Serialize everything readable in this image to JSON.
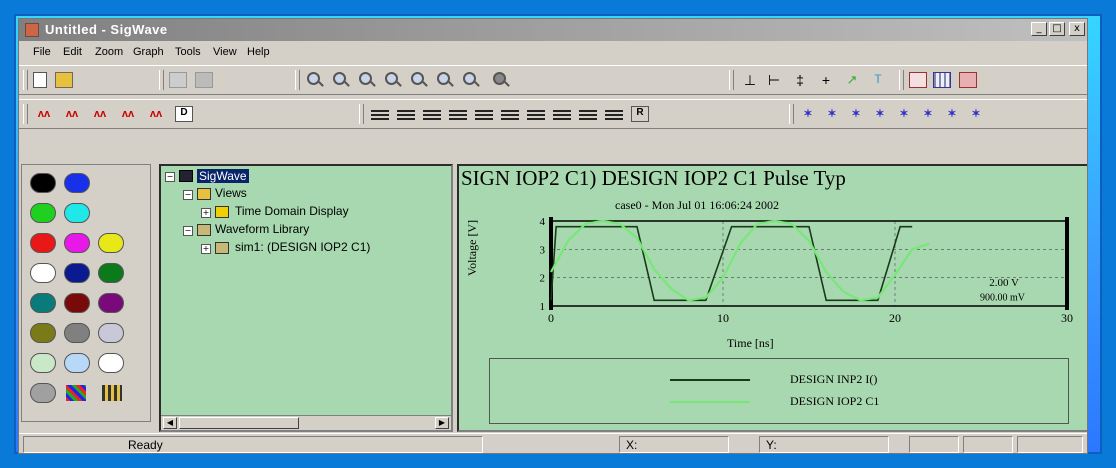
{
  "window": {
    "title": "Untitled - SigWave",
    "min": "_",
    "max": "□",
    "close": "x"
  },
  "menu": [
    "File",
    "Edit",
    "Zoom",
    "Graph",
    "Tools",
    "View",
    "Help"
  ],
  "tree": {
    "root": "SigWave",
    "views": "Views",
    "time_domain": "Time Domain Display",
    "library": "Waveform Library",
    "sim": "sim1: (DESIGN IOP2 C1)"
  },
  "plot": {
    "title": "SIGN IOP2 C1) DESIGN IOP2 C1 Pulse Typ",
    "subtitle": "case0 - Mon Jul 01 16:06:24 2002",
    "annotation1": "2.00 V",
    "annotation2": "900.00 mV"
  },
  "chart_data": {
    "type": "line",
    "title": "SIGN IOP2 C1) DESIGN IOP2 C1 Pulse Typ",
    "subtitle": "case0 - Mon Jul 01 16:06:24 2002",
    "xlabel": "Time [ns]",
    "ylabel": "Voltage [V]",
    "xlim": [
      0,
      30
    ],
    "ylim": [
      1,
      4
    ],
    "xticks": [
      "0",
      "10",
      "20",
      "30"
    ],
    "yticks": [
      "1",
      "2",
      "3",
      "4"
    ],
    "grid": true,
    "legend_position": "bottom",
    "series": [
      {
        "name": "DESIGN INP2 I()",
        "color": "#1a3a1a",
        "x": [
          0,
          0.3,
          2,
          5,
          6,
          9,
          10.5,
          12,
          15,
          16,
          19,
          20.3,
          21
        ],
        "y": [
          1.2,
          3.8,
          3.8,
          3.8,
          1.2,
          1.2,
          3.8,
          3.8,
          3.8,
          1.2,
          1.2,
          3.8,
          3.8
        ]
      },
      {
        "name": "DESIGN IOP2 C1",
        "color": "#77e877",
        "x": [
          0,
          1,
          2,
          3,
          4,
          5,
          6,
          7,
          8,
          9,
          10,
          11,
          12,
          13,
          14,
          15,
          16,
          17,
          18,
          19,
          20,
          21,
          22
        ],
        "y": [
          2.2,
          3.3,
          3.9,
          4.0,
          3.9,
          3.4,
          2.3,
          1.6,
          1.2,
          1.3,
          2.0,
          3.2,
          3.9,
          4.0,
          3.9,
          3.3,
          2.2,
          1.5,
          1.2,
          1.3,
          2.1,
          3.0,
          3.2
        ]
      }
    ]
  },
  "legend": [
    "DESIGN INP2 I()",
    "DESIGN IOP2 C1"
  ],
  "status": {
    "ready": "Ready",
    "x": "X:",
    "y": "Y:"
  },
  "palette_colors": [
    "#000000",
    "#1830e8",
    "#20d020",
    "#20e8e8",
    "#e81818",
    "#e818e8",
    "#e8e818",
    "#ffffff",
    "#0a1a90",
    "#0a7a1a",
    "#0a7a7a",
    "#7a0a0a",
    "#7a0a7a",
    "#7a7a18",
    "#808080",
    "#c8c8d8",
    "#c8e8c8",
    "#b8d8f8",
    "#ffffff",
    "#a0a0a0"
  ]
}
